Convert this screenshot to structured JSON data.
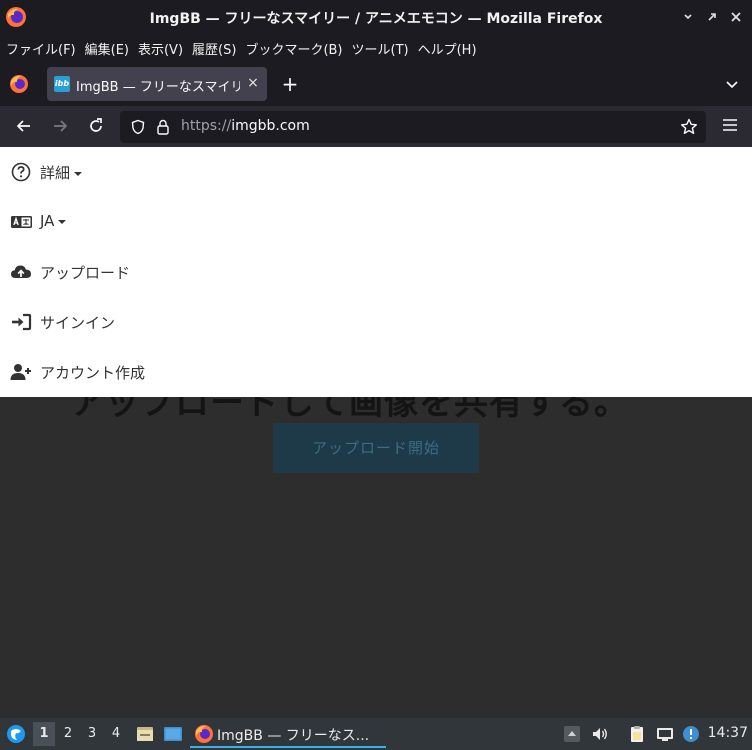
{
  "window": {
    "title": "ImgBB — フリーなスマイリー / アニメエモコン — Mozilla Firefox",
    "app_icon": "firefox-icon",
    "controls": [
      "minimize-icon",
      "maximize-icon",
      "close-icon"
    ]
  },
  "menubar": {
    "items": [
      "ファイル(F)",
      "編集(E)",
      "表示(V)",
      "履歴(S)",
      "ブックマーク(B)",
      "ツール(T)",
      "ヘルプ(H)"
    ]
  },
  "tabs": {
    "active": {
      "title": "ImgBB — フリーなスマイリー / アニメエモコン",
      "favicon_text": "ibb",
      "close": "×"
    },
    "new_tab": "+"
  },
  "navbar": {
    "url_scheme": "https://",
    "url_host": "imgbb.com"
  },
  "page": {
    "menu": {
      "details": "詳細",
      "language": "JA",
      "upload": "アップロード",
      "signin": "サインイン",
      "signup": "アカウント作成"
    },
    "hero_heading": "アップロードして画像を共有する。",
    "upload_button": "アップロード開始"
  },
  "taskbar": {
    "workspaces": [
      "1",
      "2",
      "3",
      "4"
    ],
    "active_workspace": "1",
    "task_label": "ImgBB — フリーなス...",
    "clock": "14:37"
  },
  "colors": {
    "titlebar_bg": "#1c1b22",
    "navbar_bg": "#2b2a33",
    "accent": "#3daee9",
    "brand": "#2a9fd6"
  }
}
